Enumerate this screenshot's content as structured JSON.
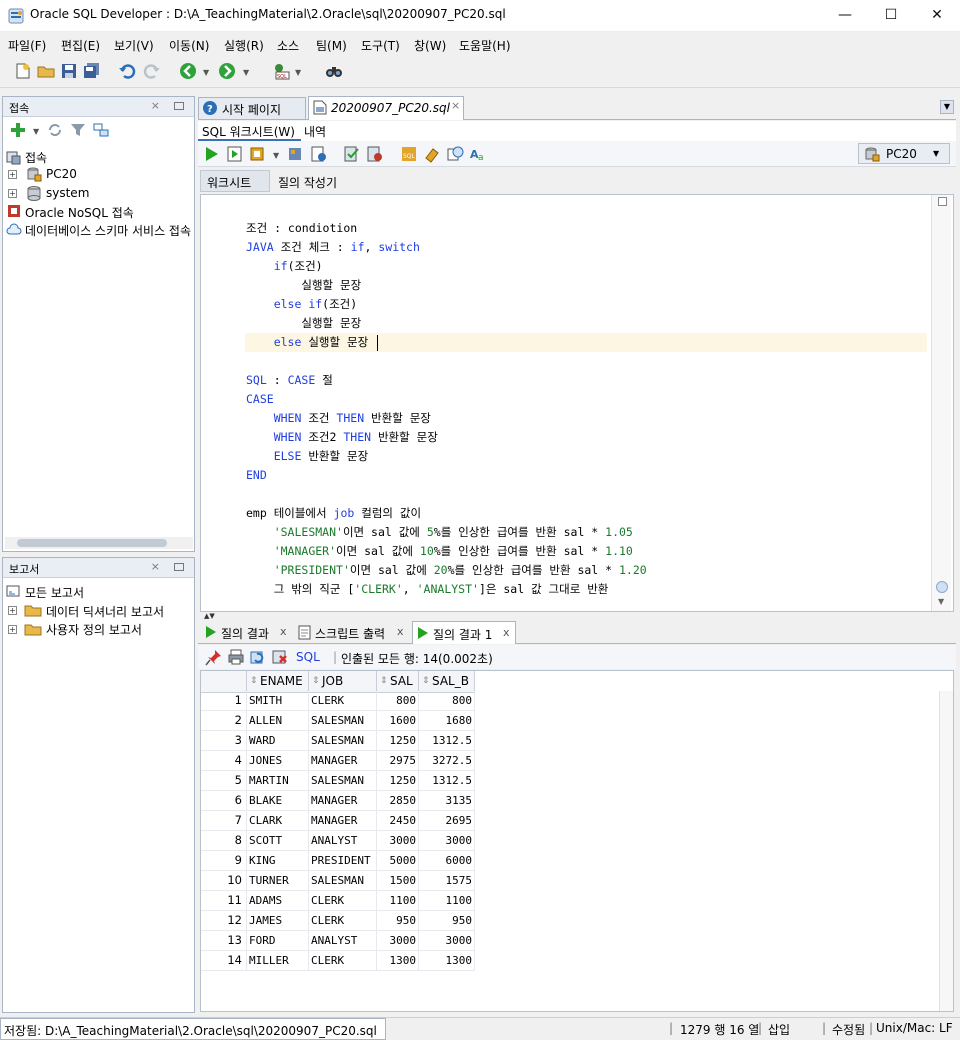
{
  "window": {
    "title": "Oracle SQL Developer : D:\\A_TeachingMaterial\\2.Oracle\\sql\\20200907_PC20.sql",
    "minimize": "—",
    "maximize": "☐",
    "close": "✕"
  },
  "menu": [
    "파일(F)",
    "편집(E)",
    "보기(V)",
    "이동(N)",
    "실행(R)",
    "소스",
    "팀(M)",
    "도구(T)",
    "창(W)",
    "도움말(H)"
  ],
  "connections_panel": {
    "title": "접속",
    "root": "접속",
    "items": [
      "PC20",
      "system"
    ],
    "nosql": "Oracle NoSQL 접속",
    "schema_service": "데이터베이스 스키마 서비스 접속"
  },
  "reports_panel": {
    "title": "보고서",
    "items": [
      "모든 보고서",
      "데이터 딕셔너리 보고서",
      "사용자 정의 보고서"
    ]
  },
  "doc_tabs": [
    "시작 페이지",
    "20200907_PC20.sql"
  ],
  "sub_tabs": [
    "SQL 워크시트(W)",
    "내역"
  ],
  "connection_select": "PC20",
  "worksheet_tabs": [
    "워크시트",
    "질의 작성기"
  ],
  "code_lines": [
    [
      {
        "t": "조건 : condiotion"
      }
    ],
    [
      {
        "t": "JAVA",
        "c": "kw"
      },
      {
        "t": " 조건 체크 : "
      },
      {
        "t": "if",
        "c": "kw"
      },
      {
        "t": ", "
      },
      {
        "t": "switch",
        "c": "kw"
      }
    ],
    [
      {
        "t": "    "
      },
      {
        "t": "if",
        "c": "kw"
      },
      {
        "t": "(조건)"
      }
    ],
    [
      {
        "t": "        실행할 문장"
      }
    ],
    [
      {
        "t": "    "
      },
      {
        "t": "else if",
        "c": "kw"
      },
      {
        "t": "(조건)"
      }
    ],
    [
      {
        "t": "        실행할 문장"
      }
    ],
    [
      {
        "t": "    "
      },
      {
        "t": "else",
        "c": "kw"
      },
      {
        "t": " 실행할 문장"
      }
    ],
    [],
    [
      {
        "t": "SQL",
        "c": "kw"
      },
      {
        "t": " : "
      },
      {
        "t": "CASE",
        "c": "kw"
      },
      {
        "t": " 절"
      }
    ],
    [
      {
        "t": "CASE",
        "c": "kw"
      }
    ],
    [
      {
        "t": "    "
      },
      {
        "t": "WHEN",
        "c": "kw"
      },
      {
        "t": " 조건 "
      },
      {
        "t": "THEN",
        "c": "kw"
      },
      {
        "t": " 반환할 문장"
      }
    ],
    [
      {
        "t": "    "
      },
      {
        "t": "WHEN",
        "c": "kw"
      },
      {
        "t": " 조건2 "
      },
      {
        "t": "THEN",
        "c": "kw"
      },
      {
        "t": " 반환할 문장"
      }
    ],
    [
      {
        "t": "    "
      },
      {
        "t": "ELSE",
        "c": "kw"
      },
      {
        "t": " 반환할 문장"
      }
    ],
    [
      {
        "t": "END",
        "c": "kw"
      }
    ],
    [],
    [
      {
        "t": "emp 테이블에서 "
      },
      {
        "t": "job",
        "c": "kw"
      },
      {
        "t": " 컬럼의 값이"
      }
    ],
    [
      {
        "t": "    "
      },
      {
        "t": "'SALESMAN'",
        "c": "str"
      },
      {
        "t": "이면 sal 값에 "
      },
      {
        "t": "5",
        "c": "num"
      },
      {
        "t": "%를 인상한 급여를 반환 sal * "
      },
      {
        "t": "1.05",
        "c": "num"
      }
    ],
    [
      {
        "t": "    "
      },
      {
        "t": "'MANAGER'",
        "c": "str"
      },
      {
        "t": "이면 sal 값에 "
      },
      {
        "t": "10",
        "c": "num"
      },
      {
        "t": "%를 인상한 급여를 반환 sal * "
      },
      {
        "t": "1.10",
        "c": "num"
      }
    ],
    [
      {
        "t": "    "
      },
      {
        "t": "'PRESIDENT'",
        "c": "str"
      },
      {
        "t": "이면 sal 값에 "
      },
      {
        "t": "20",
        "c": "num"
      },
      {
        "t": "%를 인상한 급여를 반환 sal * "
      },
      {
        "t": "1.20",
        "c": "num"
      }
    ],
    [
      {
        "t": "    그 밖의 직군 ["
      },
      {
        "t": "'CLERK'",
        "c": "str"
      },
      {
        "t": ", "
      },
      {
        "t": "'ANALYST'",
        "c": "str"
      },
      {
        "t": "]은 sal 값 그대로 반환"
      }
    ]
  ],
  "result_tabs": [
    "질의 결과",
    "스크립트 출력",
    "질의 결과 1"
  ],
  "result_toolbar": {
    "sql": "SQL",
    "status": "인출된 모든 행: 14(0.002초)"
  },
  "grid": {
    "columns": [
      "ENAME",
      "JOB",
      "SAL",
      "SAL_B"
    ],
    "rows": [
      [
        "SMITH",
        "CLERK",
        "800",
        "800"
      ],
      [
        "ALLEN",
        "SALESMAN",
        "1600",
        "1680"
      ],
      [
        "WARD",
        "SALESMAN",
        "1250",
        "1312.5"
      ],
      [
        "JONES",
        "MANAGER",
        "2975",
        "3272.5"
      ],
      [
        "MARTIN",
        "SALESMAN",
        "1250",
        "1312.5"
      ],
      [
        "BLAKE",
        "MANAGER",
        "2850",
        "3135"
      ],
      [
        "CLARK",
        "MANAGER",
        "2450",
        "2695"
      ],
      [
        "SCOTT",
        "ANALYST",
        "3000",
        "3000"
      ],
      [
        "KING",
        "PRESIDENT",
        "5000",
        "6000"
      ],
      [
        "TURNER",
        "SALESMAN",
        "1500",
        "1575"
      ],
      [
        "ADAMS",
        "CLERK",
        "1100",
        "1100"
      ],
      [
        "JAMES",
        "CLERK",
        "950",
        "950"
      ],
      [
        "FORD",
        "ANALYST",
        "3000",
        "3000"
      ],
      [
        "MILLER",
        "CLERK",
        "1300",
        "1300"
      ]
    ]
  },
  "status": {
    "saved": "저장됨: D:\\A_TeachingMaterial\\2.Oracle\\sql\\20200907_PC20.sql",
    "position": "1279 행 16 열",
    "mode": "삽입",
    "modified": "수정됨",
    "eol": "Unix/Mac: LF"
  },
  "colors": {
    "keyword": "#1f3ee0",
    "string": "#1a7a2b",
    "run_green": "#22a322",
    "panel_border": "#a9b5c5"
  }
}
